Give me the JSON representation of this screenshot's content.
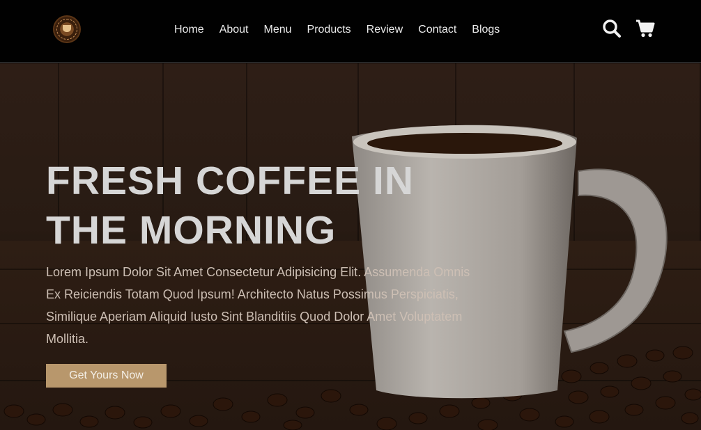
{
  "brand": {
    "logo_icon": "coffee-logo-icon"
  },
  "nav": {
    "items": [
      {
        "label": "Home"
      },
      {
        "label": "About"
      },
      {
        "label": "Menu"
      },
      {
        "label": "Products"
      },
      {
        "label": "Review"
      },
      {
        "label": "Contact"
      },
      {
        "label": "Blogs"
      }
    ]
  },
  "header_icons": {
    "search": "search-icon",
    "cart": "cart-icon"
  },
  "hero": {
    "title_line1": "FRESH COFFEE IN",
    "title_line2": "THE MORNING",
    "text": "Lorem Ipsum Dolor Sit Amet Consectetur Adipisicing Elit. Assumenda Omnis Ex Reiciendis Totam Quod Ipsum! Architecto Natus Possimus Perspiciatis, Similique Aperiam Aliquid Iusto Sint Blanditiis Quod Dolor Amet Voluptatem Mollitia.",
    "cta_label": "Get Yours Now"
  },
  "colors": {
    "header_bg": "#010101",
    "accent": "#b8976c",
    "title": "#d6d6d6",
    "text": "#cdbfb4"
  }
}
